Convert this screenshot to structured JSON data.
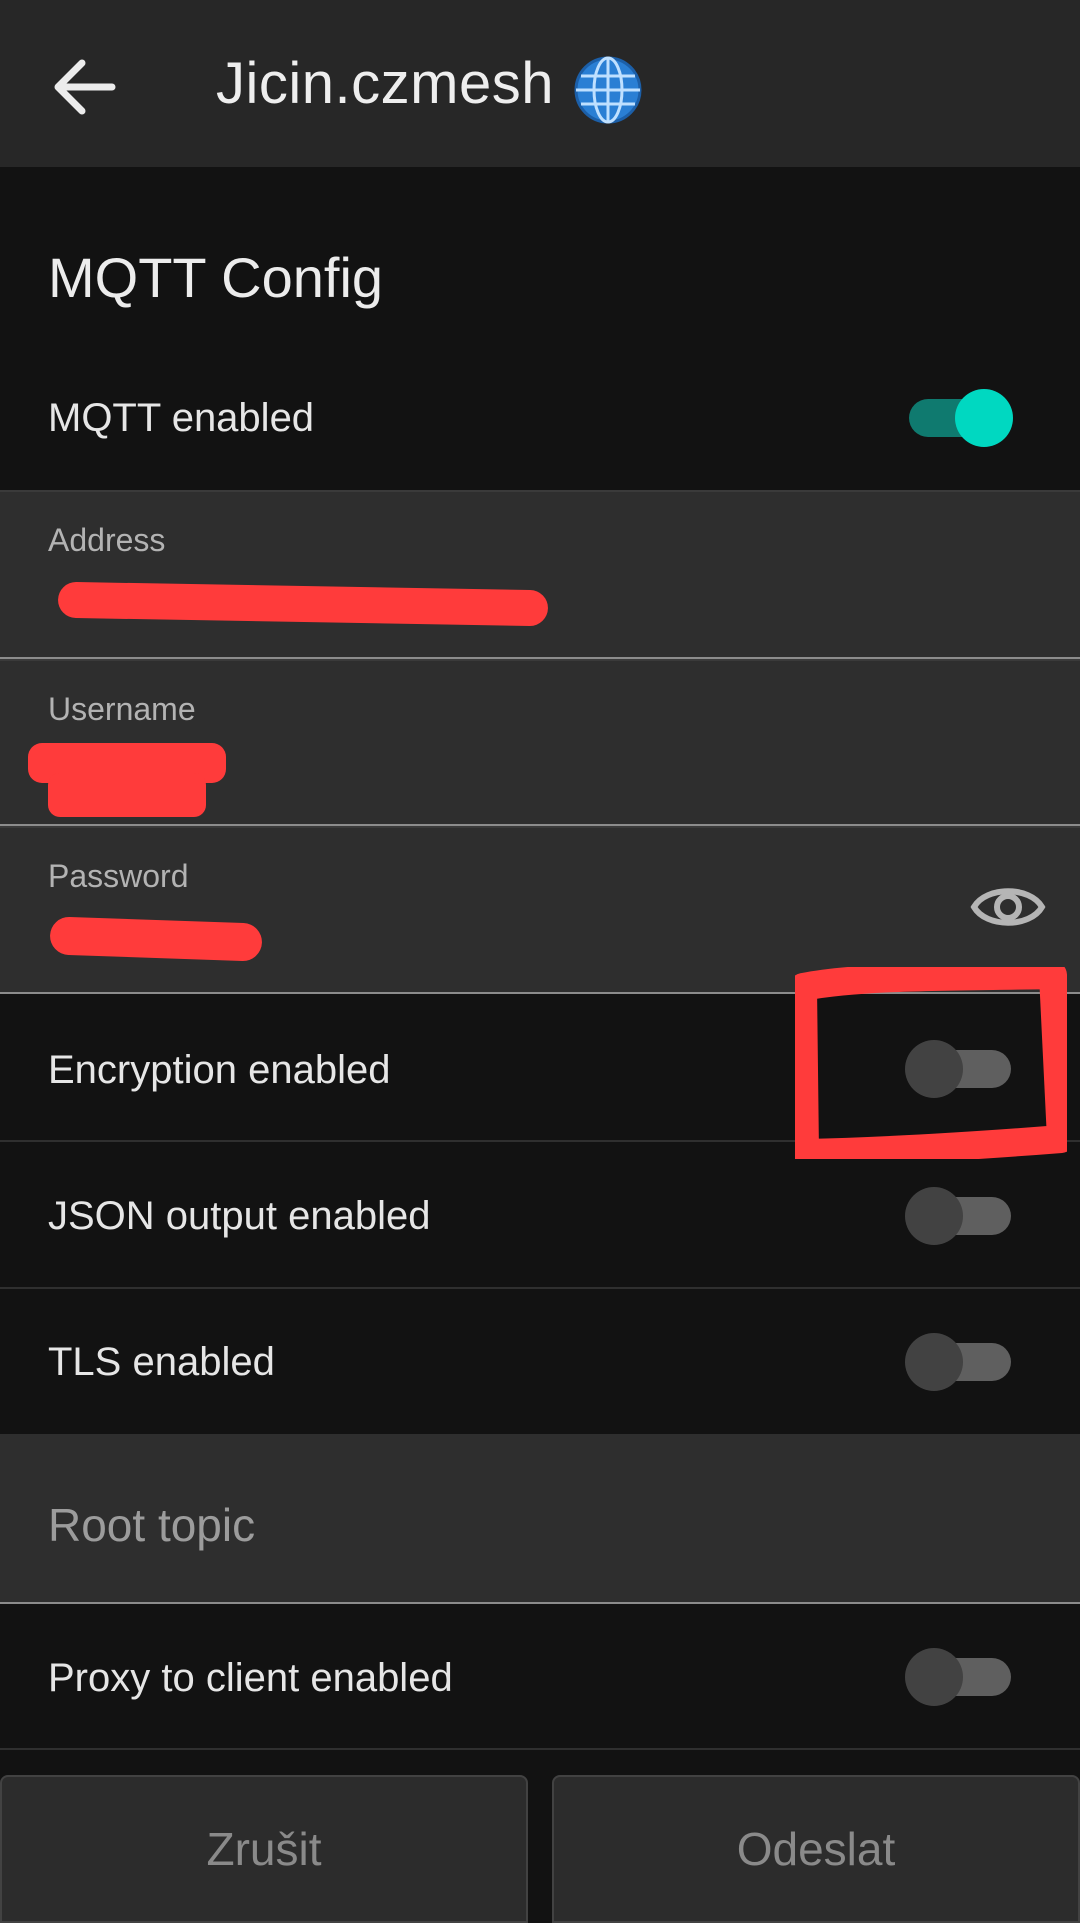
{
  "header": {
    "title": "Jicin.czmesh",
    "globe_emoji": "🌐"
  },
  "section": {
    "title": "MQTT Config"
  },
  "rows": {
    "mqtt_enabled": {
      "label": "MQTT enabled",
      "checked": true
    },
    "encryption_enabled": {
      "label": "Encryption enabled",
      "checked": false
    },
    "json_output_enabled": {
      "label": "JSON output enabled",
      "checked": false
    },
    "tls_enabled": {
      "label": "TLS enabled",
      "checked": false
    },
    "proxy_to_client_enabled": {
      "label": "Proxy to client enabled",
      "checked": false
    }
  },
  "fields": {
    "address": {
      "label": "Address",
      "value": ""
    },
    "username": {
      "label": "Username",
      "value": ""
    },
    "password": {
      "label": "Password",
      "value": ""
    },
    "root_topic": {
      "placeholder": "Root topic"
    }
  },
  "buttons": {
    "cancel": "Zrušit",
    "submit": "Odeslat"
  },
  "colors": {
    "accent": "#00d8c1",
    "background": "#121212",
    "markup_red": "#ff3b3b"
  },
  "icons": [
    "arrow-back-icon",
    "globe-icon",
    "eye-icon"
  ]
}
